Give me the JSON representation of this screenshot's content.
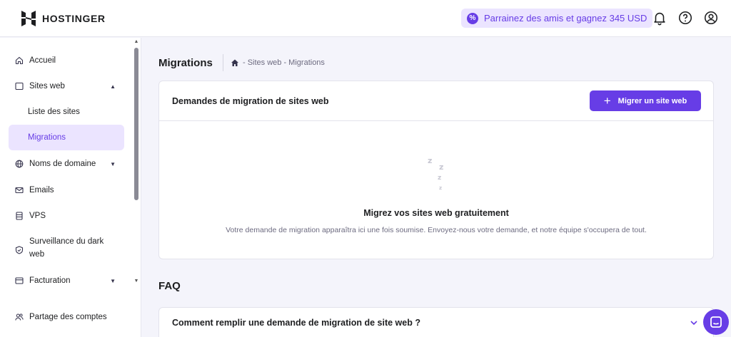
{
  "brand": {
    "name": "HOSTINGER",
    "accent": "#673de6"
  },
  "header": {
    "referral_text": "Parrainez des amis et gagnez 345 USD",
    "icons": [
      "bell-icon",
      "help-icon",
      "account-icon"
    ]
  },
  "sidebar": {
    "items": [
      {
        "label": "Accueil",
        "icon": "home-icon"
      },
      {
        "label": "Sites web",
        "icon": "window-icon",
        "expanded": true
      },
      {
        "label": "Liste des sites",
        "sub": true
      },
      {
        "label": "Migrations",
        "sub": true,
        "active": true
      },
      {
        "label": "Noms de domaine",
        "icon": "globe-icon",
        "expandable": true
      },
      {
        "label": "Emails",
        "icon": "mail-icon"
      },
      {
        "label": "VPS",
        "icon": "server-icon"
      },
      {
        "label": "Surveillance du dark web",
        "icon": "shield-icon"
      },
      {
        "label": "Facturation",
        "icon": "billing-icon",
        "expandable": true
      },
      {
        "label": "Partage des comptes",
        "icon": "users-icon"
      }
    ]
  },
  "page": {
    "title": "Migrations",
    "breadcrumb": "- Sites web - Migrations"
  },
  "migrations_card": {
    "title": "Demandes de migration de sites web",
    "button_label": "Migrer un site web",
    "empty_title": "Migrez vos sites web gratuitement",
    "empty_desc": "Votre demande de migration apparaîtra ici une fois soumise. Envoyez-nous votre demande, et notre équipe s'occupera de tout."
  },
  "faq": {
    "title": "FAQ",
    "questions": [
      "Comment remplir une demande de migration de site web ?"
    ]
  }
}
